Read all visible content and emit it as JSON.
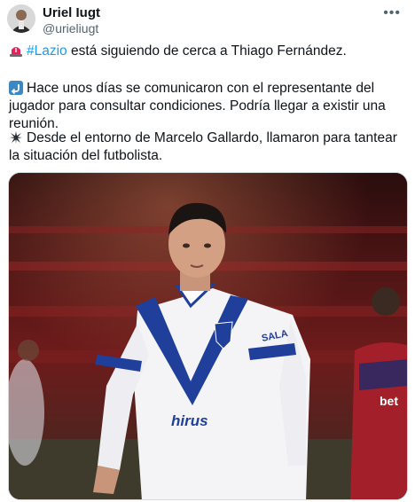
{
  "author": {
    "name": "Uriel Iugt",
    "handle": "@urieliugt"
  },
  "tweet": {
    "line1_hashtag": "#Lazio",
    "line1_text": " está siguiendo de cerca a Thiago Fernández.",
    "line2_text": "Hace unos días se comunicaron con el representante del jugador para consultar condiciones. Podría llegar a existir una reunión.",
    "line3_text": "Desde el entorno de Marcelo Gallardo, llamaron para tantear la situación del futbolista."
  },
  "icons": {
    "siren": "police-light-icon",
    "return": "return-arrow-icon",
    "star": "spark-icon",
    "more": "more-icon"
  },
  "media": {
    "sponsor_chest": "hirus",
    "sponsor_sleeve": "SALA",
    "right_player_sponsor": "bet"
  },
  "colors": {
    "link": "#1d9bf0",
    "jersey_blue": "#1f3f9a",
    "stadium_red": "#7a1c1c"
  }
}
